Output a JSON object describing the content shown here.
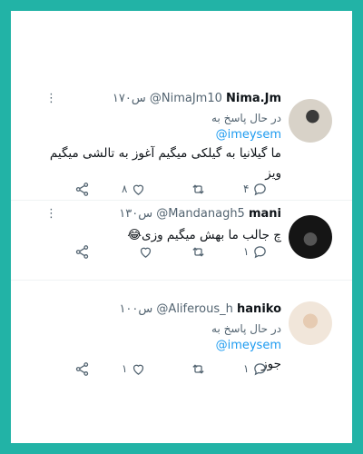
{
  "tweets": [
    {
      "name": "Nima.Jm",
      "handle": "@NimaJm10",
      "time": "۱۷۰س",
      "reply_to_label": "در حال پاسخ به",
      "mention": "@imeysem",
      "text_line1": "ما گیلانیا به گیلکی میگیم آغوز به تالشی میگیم",
      "text_line2": "ویز",
      "reply_count": "۴",
      "retweet_count": "",
      "like_count": "۸"
    },
    {
      "name": "mani",
      "handle": "@Mandanagh5",
      "time": "۱۳۰س",
      "text": "چ جالب ما بهش میگیم وزی😂",
      "reply_count": "۱",
      "retweet_count": "",
      "like_count": ""
    },
    {
      "name": "haniko",
      "handle": "@Aliferous_h",
      "time": "۱۰۰س",
      "reply_to_label": "در حال پاسخ به",
      "mention": "@imeysem",
      "text": "جوز",
      "reply_count": "۱",
      "retweet_count": "",
      "like_count": "۱"
    }
  ],
  "icons": [
    "more-icon",
    "reply-icon",
    "retweet-icon",
    "like-icon",
    "share-icon"
  ],
  "colors": {
    "frame": "#22b3a6",
    "mention": "#1d9bf0",
    "muted": "#536471"
  }
}
